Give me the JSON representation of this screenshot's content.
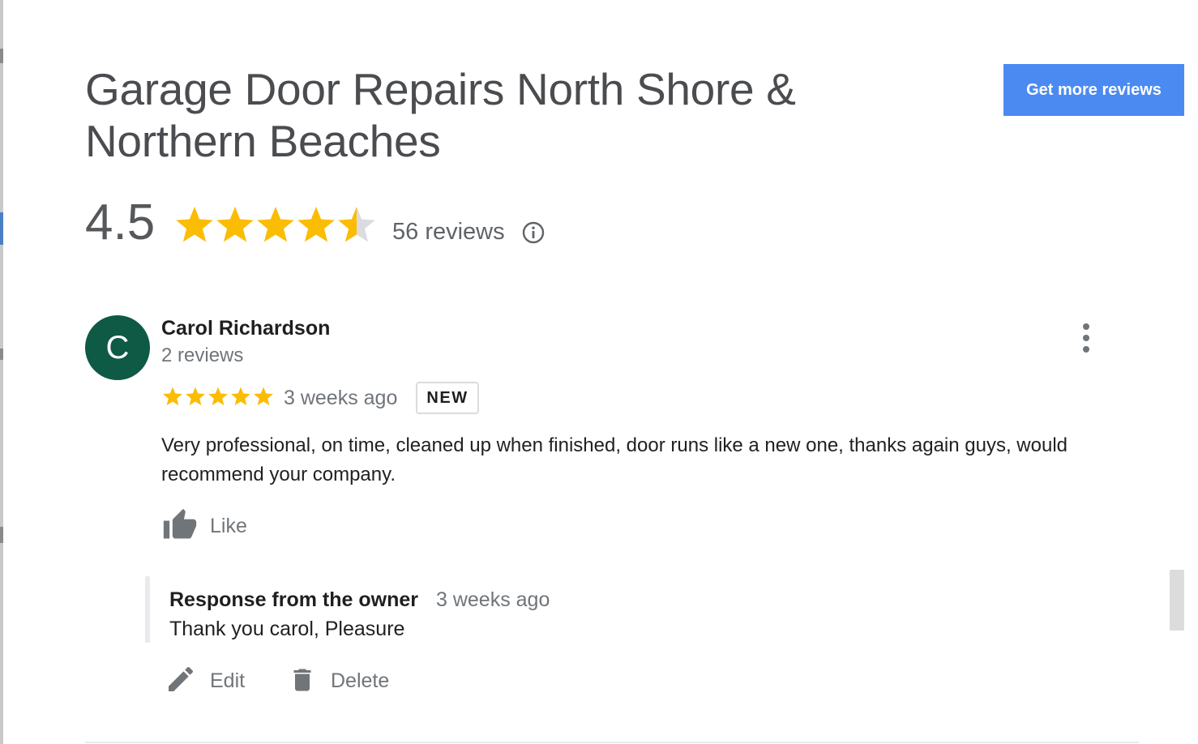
{
  "business": {
    "title_line1": "Garage Door Repairs North Shore &",
    "title_line2": "Northern Beaches",
    "cta_label": "Get more reviews",
    "rating_value": "4.5",
    "rating_stars": 4.5,
    "review_count_label": "56 reviews",
    "info_icon": "info-circle-icon"
  },
  "review": {
    "avatar_initial": "C",
    "avatar_color": "#0e5a44",
    "reviewer_name": "Carol Richardson",
    "reviewer_meta": "2 reviews",
    "stars": 5,
    "time_ago": "3 weeks ago",
    "badge": "NEW",
    "text": "Very professional, on time, cleaned up when finished, door runs like a new one, thanks again guys, would recommend your company.",
    "like_label": "Like",
    "more_icon": "more-vertical-icon"
  },
  "response": {
    "title": "Response from the owner",
    "time_ago": "3 weeks ago",
    "text": "Thank you carol, Pleasure"
  },
  "actions": {
    "edit_label": "Edit",
    "delete_label": "Delete"
  },
  "colors": {
    "accent": "#4b8af1",
    "star": "#fbbc04",
    "star_empty": "#dadce0",
    "muted_text": "#70757a"
  }
}
